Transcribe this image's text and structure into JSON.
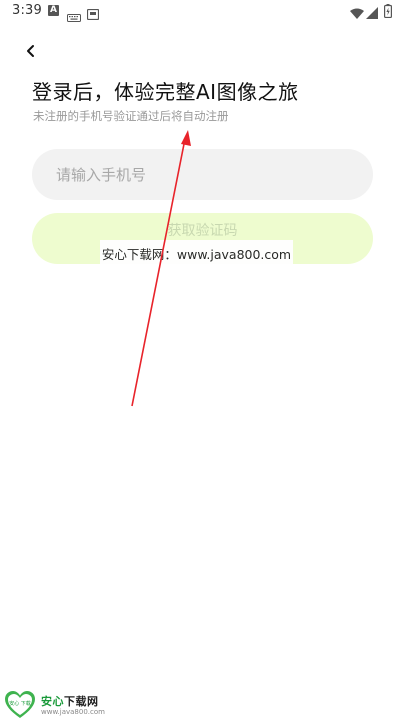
{
  "status_bar": {
    "time": "3:39",
    "icons": [
      "notification-a-icon",
      "keyboard-icon",
      "sd-card-icon",
      "wifi-icon",
      "signal-icon",
      "battery-charging-icon"
    ]
  },
  "nav": {
    "back_icon": "chevron-left-icon"
  },
  "login": {
    "title": "登录后，体验完整AI图像之旅",
    "subtitle": "未注册的手机号验证通过后将自动注册",
    "phone_placeholder": "请输入手机号",
    "phone_value": "",
    "code_button_label": "获取验证码"
  },
  "watermark": {
    "banner_text": "安心下载网：www.java800.com",
    "logo_name_green": "安心",
    "logo_name_dark": "下载网",
    "logo_url": "www.java800.com",
    "logo_badge_text": "安心 下载"
  },
  "colors": {
    "button_bg": "#eefccf",
    "input_bg": "#f2f2f2",
    "arrow": "#e8232a",
    "logo_green": "#1a9a3a"
  }
}
